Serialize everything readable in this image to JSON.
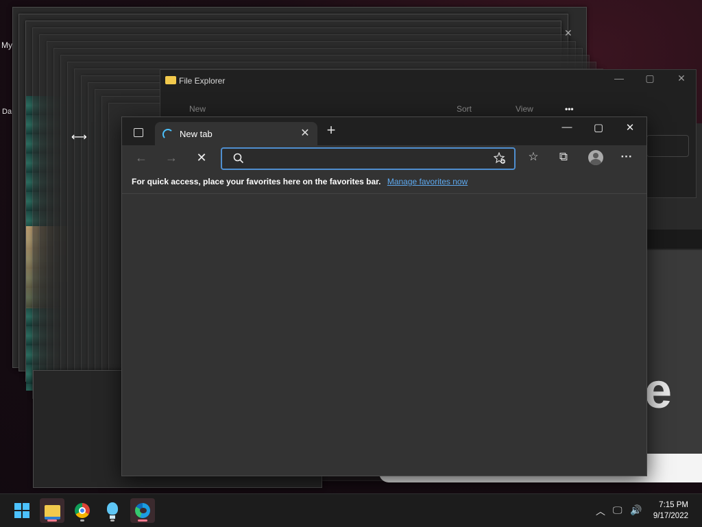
{
  "desktop": {
    "icon_label_1": "My",
    "icon_label_2": "Da"
  },
  "file_explorer": {
    "title": "File Explorer",
    "toolbar": {
      "new": "New",
      "sort": "Sort",
      "view": "View",
      "more": "•••"
    },
    "controls": {
      "minimize": "—",
      "maximize": "▢",
      "close": "✕"
    }
  },
  "edge": {
    "tab": {
      "title": "New tab",
      "close": "✕"
    },
    "new_tab": "+",
    "window_controls": {
      "minimize": "—",
      "maximize": "▢",
      "close": "✕"
    },
    "nav": {
      "back": "←",
      "forward": "→",
      "stop": "✕"
    },
    "address": {
      "value": "",
      "placeholder": ""
    },
    "favbar": {
      "text": "For quick access, place your favorites here on the favorites bar.",
      "link": "Manage favorites now"
    },
    "more": "···"
  },
  "taskbar": {
    "apps": [
      "start",
      "file-explorer",
      "chrome",
      "tips",
      "edge"
    ],
    "time": "7:15 PM",
    "date": "9/17/2022"
  },
  "colors": {
    "accent": "#4cc2ff",
    "link": "#5ea9ef",
    "address_border": "#4f8fd0"
  }
}
